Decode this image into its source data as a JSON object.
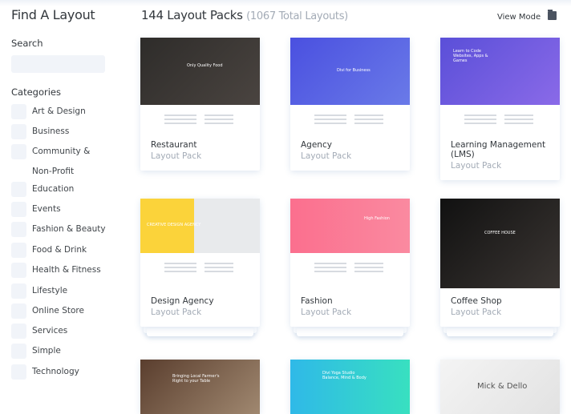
{
  "sidebar": {
    "title": "Find A Layout",
    "search_label": "Search",
    "search_value": "",
    "categories_label": "Categories",
    "categories": [
      "Art & Design",
      "Business",
      "Community & Non-Profit",
      "Education",
      "Events",
      "Fashion & Beauty",
      "Food & Drink",
      "Health & Fitness",
      "Lifestyle",
      "Online Store",
      "Services",
      "Simple",
      "Technology"
    ]
  },
  "header": {
    "title": "144 Layout Packs",
    "subtitle": "(1067 Total Layouts)",
    "view_mode": "View Mode"
  },
  "cards": [
    {
      "title": "Restaurant",
      "subtitle": "Layout Pack",
      "preview": "Only Quality Food",
      "color": "#3a3836"
    },
    {
      "title": "Agency",
      "subtitle": "Layout Pack",
      "preview": "Divi for Business",
      "color": "#5058de"
    },
    {
      "title": "Learning Management (LMS)",
      "subtitle": "Layout Pack",
      "preview": "Learn to Code Websites, Apps & Games",
      "color": "#6d5ce0"
    },
    {
      "title": "Design Agency",
      "subtitle": "Layout Pack",
      "preview": "CREATIVE DESIGN AGENCY",
      "color": "#fbd33a"
    },
    {
      "title": "Fashion",
      "subtitle": "Layout Pack",
      "preview": "High Fashion",
      "color": "#f87892"
    },
    {
      "title": "Coffee Shop",
      "subtitle": "Layout Pack",
      "preview": "COFFEE HOUSE",
      "color": "#1e1e1e"
    },
    {
      "title": "",
      "subtitle": "",
      "preview": "Bringing Local Farmer's Right to your Table",
      "color": "#6b4e3a"
    },
    {
      "title": "",
      "subtitle": "",
      "preview": "Divi Yoga Studio Balance, Mind & Body",
      "color": "#2fc7e0"
    },
    {
      "title": "",
      "subtitle": "",
      "preview": "Mick & Dello",
      "color": "#eeeeee"
    }
  ]
}
